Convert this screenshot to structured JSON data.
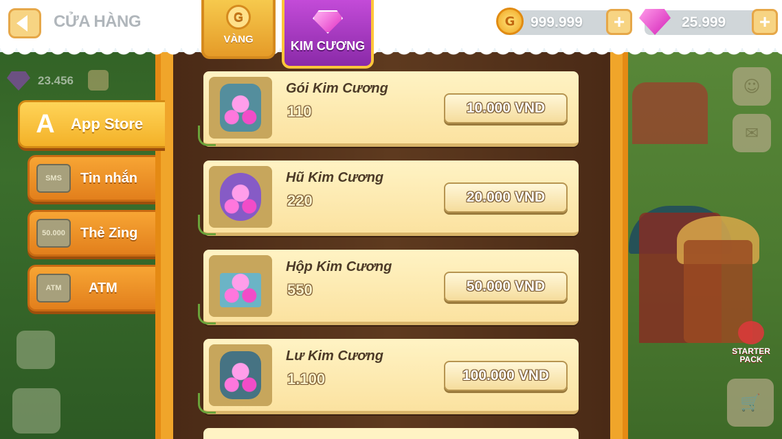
{
  "header": {
    "title": "CỬA HÀNG",
    "back_icon": "back-arrow-icon"
  },
  "tabs": [
    {
      "label": "VÀNG",
      "icon": "gold-coin-icon",
      "active": false
    },
    {
      "label": "KIM CƯƠNG",
      "icon": "diamond-icon",
      "active": true
    }
  ],
  "currency": {
    "gold": {
      "value": "999.999",
      "icon": "gold-coin-icon"
    },
    "gem": {
      "value": "25.999",
      "icon": "diamond-icon"
    },
    "plus_symbol": "+"
  },
  "background_hud": {
    "gem_value": "23.456"
  },
  "payment_methods": [
    {
      "label": "App Store",
      "icon": "app-store-icon",
      "active": true
    },
    {
      "label": "Tin nhắn",
      "icon": "sms-phone-icon",
      "icon_text": "SMS",
      "active": false
    },
    {
      "label": "Thẻ Zing",
      "icon": "zing-card-icon",
      "icon_text": "50.000",
      "active": false
    },
    {
      "label": "ATM",
      "icon": "atm-card-icon",
      "icon_text": "ATM",
      "active": false
    }
  ],
  "items": [
    {
      "name": "Gói Kim Cương",
      "quantity": "110",
      "price": "10.000 VND",
      "icon": "diamond-bag-icon"
    },
    {
      "name": "Hũ Kim Cương",
      "quantity": "220",
      "price": "20.000 VND",
      "icon": "diamond-jar-icon"
    },
    {
      "name": "Hộp Kim Cương",
      "quantity": "550",
      "price": "50.000 VND",
      "icon": "diamond-box-icon"
    },
    {
      "name": "Lư Kim Cương",
      "quantity": "1.100",
      "price": "100.000 VND",
      "icon": "diamond-urn-icon"
    }
  ],
  "side_buttons": {
    "starter_pack": "STARTER PACK"
  },
  "colors": {
    "panel_orange": "#f0a52a",
    "panel_wood": "#5e3a1f",
    "diamond_tab": "#8a2aa8",
    "card_bg": "#fff3c4"
  }
}
